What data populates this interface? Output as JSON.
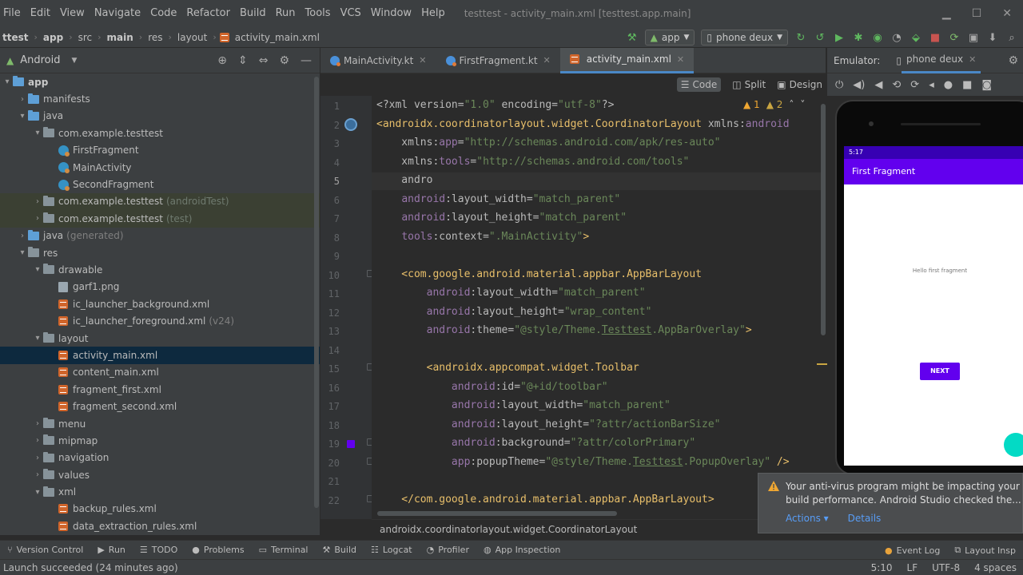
{
  "menubar": {
    "items": [
      "File",
      "Edit",
      "View",
      "Navigate",
      "Code",
      "Refactor",
      "Build",
      "Run",
      "Tools",
      "VCS",
      "Window",
      "Help"
    ],
    "window_title": "testtest - activity_main.xml [testtest.app.main]"
  },
  "navbar": {
    "crumbs": [
      "ttest",
      "app",
      "src",
      "main",
      "res",
      "layout"
    ],
    "file": "activity_main.xml",
    "run_config": "app",
    "device": "phone deux"
  },
  "project": {
    "view_mode": "Android",
    "tree": [
      {
        "label": "app",
        "indent": 0,
        "arrow": "▾",
        "icon": "folder-blue",
        "bold": true
      },
      {
        "label": "manifests",
        "indent": 1,
        "arrow": "›",
        "icon": "folder-blue"
      },
      {
        "label": "java",
        "indent": 1,
        "arrow": "▾",
        "icon": "folder-blue"
      },
      {
        "label": "com.example.testtest",
        "indent": 2,
        "arrow": "▾",
        "icon": "folder"
      },
      {
        "label": "FirstFragment",
        "indent": 3,
        "arrow": "",
        "icon": "class"
      },
      {
        "label": "MainActivity",
        "indent": 3,
        "arrow": "",
        "icon": "class"
      },
      {
        "label": "SecondFragment",
        "indent": 3,
        "arrow": "",
        "icon": "class"
      },
      {
        "label": "com.example.testtest",
        "suffix": "(androidTest)",
        "indent": 2,
        "arrow": "›",
        "icon": "folder",
        "test": true
      },
      {
        "label": "com.example.testtest",
        "suffix": "(test)",
        "indent": 2,
        "arrow": "›",
        "icon": "folder",
        "test": true
      },
      {
        "label": "java",
        "suffix": "(generated)",
        "indent": 1,
        "arrow": "›",
        "icon": "folder-blue"
      },
      {
        "label": "res",
        "indent": 1,
        "arrow": "▾",
        "icon": "folder"
      },
      {
        "label": "drawable",
        "indent": 2,
        "arrow": "▾",
        "icon": "folder"
      },
      {
        "label": "garf1.png",
        "indent": 3,
        "arrow": "",
        "icon": "png"
      },
      {
        "label": "ic_launcher_background.xml",
        "indent": 3,
        "arrow": "",
        "icon": "xml"
      },
      {
        "label": "ic_launcher_foreground.xml",
        "suffix": "(v24)",
        "indent": 3,
        "arrow": "",
        "icon": "xml"
      },
      {
        "label": "layout",
        "indent": 2,
        "arrow": "▾",
        "icon": "folder"
      },
      {
        "label": "activity_main.xml",
        "indent": 3,
        "arrow": "",
        "icon": "xml",
        "selected": true
      },
      {
        "label": "content_main.xml",
        "indent": 3,
        "arrow": "",
        "icon": "xml"
      },
      {
        "label": "fragment_first.xml",
        "indent": 3,
        "arrow": "",
        "icon": "xml"
      },
      {
        "label": "fragment_second.xml",
        "indent": 3,
        "arrow": "",
        "icon": "xml"
      },
      {
        "label": "menu",
        "indent": 2,
        "arrow": "›",
        "icon": "folder"
      },
      {
        "label": "mipmap",
        "indent": 2,
        "arrow": "›",
        "icon": "folder"
      },
      {
        "label": "navigation",
        "indent": 2,
        "arrow": "›",
        "icon": "folder"
      },
      {
        "label": "values",
        "indent": 2,
        "arrow": "›",
        "icon": "folder"
      },
      {
        "label": "xml",
        "indent": 2,
        "arrow": "▾",
        "icon": "folder"
      },
      {
        "label": "backup_rules.xml",
        "indent": 3,
        "arrow": "",
        "icon": "xml"
      },
      {
        "label": "data_extraction_rules.xml",
        "indent": 3,
        "arrow": "",
        "icon": "xml"
      }
    ]
  },
  "tabs": [
    {
      "label": "MainActivity.kt",
      "icon": "kt"
    },
    {
      "label": "FirstFragment.kt",
      "icon": "kt"
    },
    {
      "label": "activity_main.xml",
      "icon": "xml",
      "active": true
    }
  ],
  "view_modes": [
    "Code",
    "Split",
    "Design"
  ],
  "editor": {
    "current_line": 5,
    "warnings": "▲ 1",
    "weak_warnings": "▲ 2",
    "lines": [
      [
        [
          "<?xml version=",
          "c-attr"
        ],
        [
          "\"1.0\"",
          "c-val"
        ],
        [
          " encoding=",
          "c-attr"
        ],
        [
          "\"utf-8\"",
          "c-val"
        ],
        [
          "?>",
          "c-attr"
        ]
      ],
      [
        [
          "<androidx.coordinatorlayout.widget.CoordinatorLayout ",
          "c-tag"
        ],
        [
          "xmlns:",
          "c-attr"
        ],
        [
          "android",
          "c-ns"
        ]
      ],
      [
        [
          "    xmlns:",
          "c-attr"
        ],
        [
          "app",
          "c-ns"
        ],
        [
          "=",
          "c-attr"
        ],
        [
          "\"http://schemas.android.com/apk/res-auto\"",
          "c-val"
        ]
      ],
      [
        [
          "    xmlns:",
          "c-attr"
        ],
        [
          "tools",
          "c-ns"
        ],
        [
          "=",
          "c-attr"
        ],
        [
          "\"http://schemas.android.com/tools\"",
          "c-val"
        ]
      ],
      [
        [
          "    andro",
          "c-attr"
        ]
      ],
      [
        [
          "    ",
          "c-attr"
        ],
        [
          "android",
          "c-ns"
        ],
        [
          ":layout_width=",
          "c-attr"
        ],
        [
          "\"match_parent\"",
          "c-val"
        ]
      ],
      [
        [
          "    ",
          "c-attr"
        ],
        [
          "android",
          "c-ns"
        ],
        [
          ":layout_height=",
          "c-attr"
        ],
        [
          "\"match_parent\"",
          "c-val"
        ]
      ],
      [
        [
          "    ",
          "c-attr"
        ],
        [
          "tools",
          "c-ns"
        ],
        [
          ":context=",
          "c-attr"
        ],
        [
          "\".MainActivity\"",
          "c-val"
        ],
        [
          ">",
          "c-tag"
        ]
      ],
      [
        [
          "",
          "c-attr"
        ]
      ],
      [
        [
          "    <com.google.android.material.appbar.AppBarLayout",
          "c-tag"
        ]
      ],
      [
        [
          "        ",
          "c-attr"
        ],
        [
          "android",
          "c-ns"
        ],
        [
          ":layout_width=",
          "c-attr"
        ],
        [
          "\"match_parent\"",
          "c-val"
        ]
      ],
      [
        [
          "        ",
          "c-attr"
        ],
        [
          "android",
          "c-ns"
        ],
        [
          ":layout_height=",
          "c-attr"
        ],
        [
          "\"wrap_content\"",
          "c-val"
        ]
      ],
      [
        [
          "        ",
          "c-attr"
        ],
        [
          "android",
          "c-ns"
        ],
        [
          ":theme=",
          "c-attr"
        ],
        [
          "\"@style/Theme.",
          "c-val"
        ],
        [
          "Testtest",
          "c-val c-u"
        ],
        [
          ".AppBarOverlay\"",
          "c-val"
        ],
        [
          ">",
          "c-tag"
        ]
      ],
      [
        [
          "",
          "c-attr"
        ]
      ],
      [
        [
          "        <androidx.appcompat.widget.Toolbar",
          "c-tag"
        ]
      ],
      [
        [
          "            ",
          "c-attr"
        ],
        [
          "android",
          "c-ns"
        ],
        [
          ":id=",
          "c-attr"
        ],
        [
          "\"@+id/toolbar\"",
          "c-val"
        ]
      ],
      [
        [
          "            ",
          "c-attr"
        ],
        [
          "android",
          "c-ns"
        ],
        [
          ":layout_width=",
          "c-attr"
        ],
        [
          "\"match_parent\"",
          "c-val"
        ]
      ],
      [
        [
          "            ",
          "c-attr"
        ],
        [
          "android",
          "c-ns"
        ],
        [
          ":layout_height=",
          "c-attr"
        ],
        [
          "\"?attr/actionBarSize\"",
          "c-val"
        ]
      ],
      [
        [
          "            ",
          "c-attr"
        ],
        [
          "android",
          "c-ns"
        ],
        [
          ":background=",
          "c-attr"
        ],
        [
          "\"?attr/colorPrimary\"",
          "c-val"
        ]
      ],
      [
        [
          "            ",
          "c-attr"
        ],
        [
          "app",
          "c-ns"
        ],
        [
          ":popupTheme=",
          "c-attr"
        ],
        [
          "\"@style/Theme.",
          "c-val"
        ],
        [
          "Testtest",
          "c-val c-u"
        ],
        [
          ".PopupOverlay\"",
          "c-val"
        ],
        [
          " />",
          "c-tag"
        ]
      ],
      [
        [
          "",
          "c-attr"
        ]
      ],
      [
        [
          "    </com.google.android.material.appbar.AppBarLayout>",
          "c-tag"
        ]
      ]
    ],
    "breadcrumb": "androidx.coordinatorlayout.widget.CoordinatorLayout"
  },
  "emulator": {
    "label": "Emulator:",
    "device": "phone deux",
    "status_time": "5:17",
    "app_bar_title": "First Fragment",
    "hello_text": "Hello first fragment",
    "next_button": "NEXT"
  },
  "notification": {
    "text": "Your anti-virus program might be impacting your build performance. Android Studio checked the...",
    "action1": "Actions ▾",
    "action2": "Details"
  },
  "tool_windows": [
    "Version Control",
    "Run",
    "TODO",
    "Problems",
    "Terminal",
    "Build",
    "Logcat",
    "Profiler",
    "App Inspection"
  ],
  "tool_windows_right": [
    "Event Log",
    "Layout Insp"
  ],
  "status": {
    "message": "Launch succeeded (24 minutes ago)",
    "position": "5:10",
    "line_sep": "LF",
    "encoding": "UTF-8",
    "indent": "4 spaces"
  },
  "colors": {
    "accent": "#4a88c7",
    "purple": "#6200ee",
    "warning": "#f0a732"
  }
}
